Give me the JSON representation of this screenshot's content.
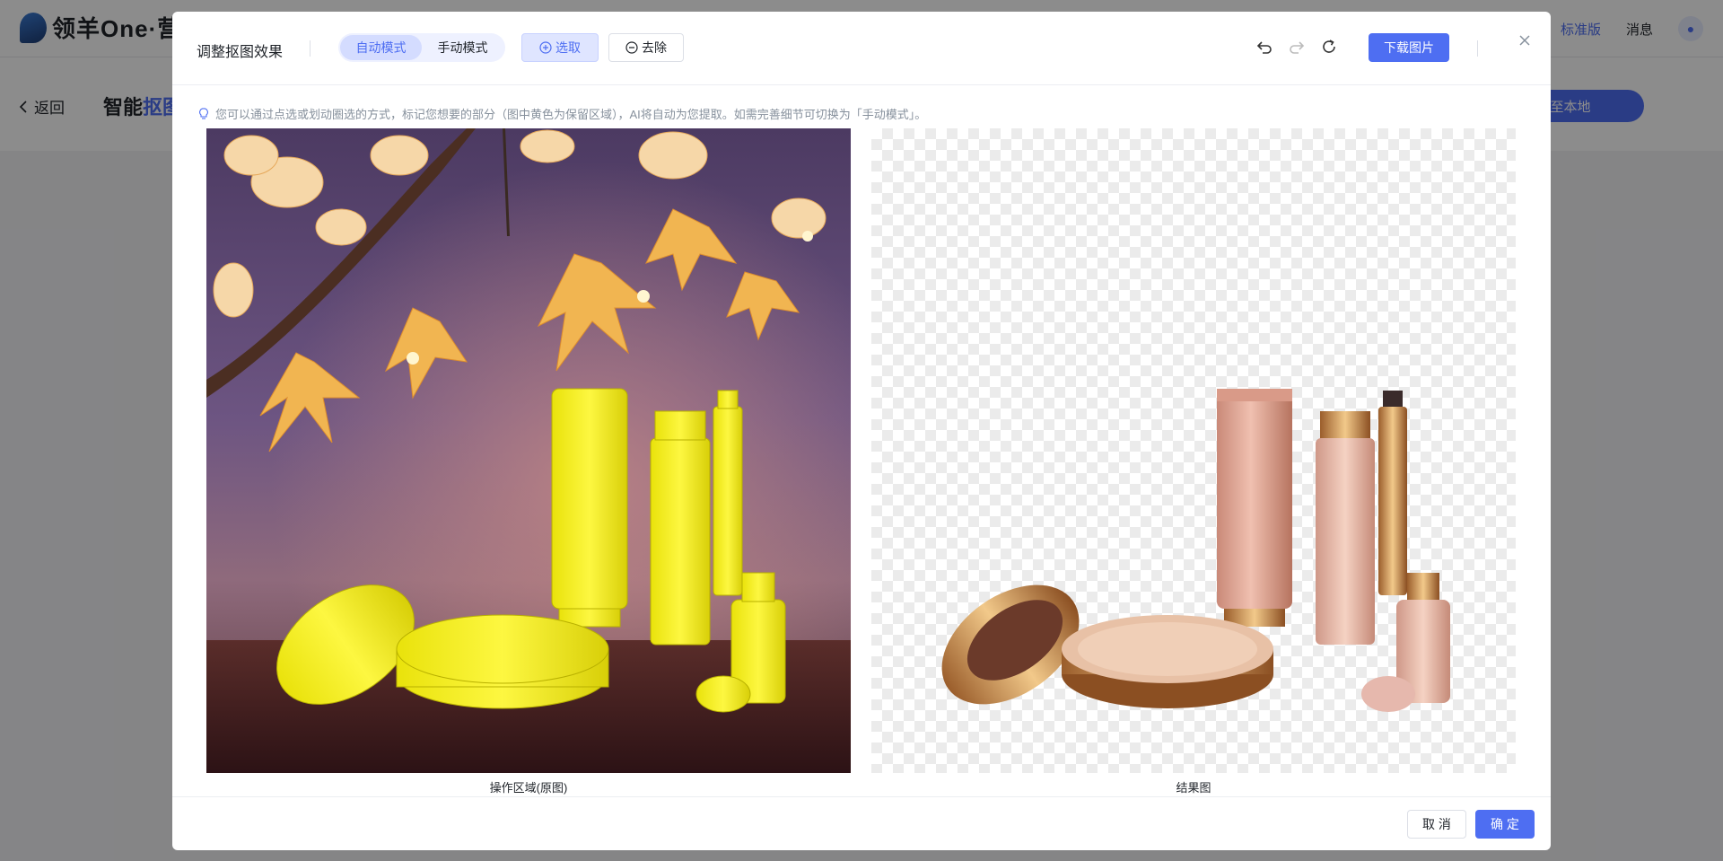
{
  "app": {
    "brand": "领羊One·营销",
    "edition_badge": "标准版",
    "messages_label": "消息"
  },
  "subbar": {
    "back_label": "返回",
    "page_title_prefix": "智能",
    "page_title_accent": "抠图",
    "download_local_label": "下载至本地"
  },
  "modal": {
    "title": "调整抠图效果",
    "modes": [
      {
        "label": "自动模式",
        "active": true
      },
      {
        "label": "手动模式",
        "active": false
      }
    ],
    "select_label": "选取",
    "remove_label": "去除",
    "download_label": "下载图片",
    "hint": "您可以通过点选或划动圈选的方式，标记您想要的部分（图中黄色为保留区域），AI将自动为您提取。如需完善细节可切换为「手动模式」。",
    "left_panel_label": "操作区域(原图)",
    "right_panel_label": "结果图",
    "cancel_label": "取 消",
    "confirm_label": "确 定"
  },
  "colors": {
    "accent": "#4e6ef2",
    "highlight_yellow": "#f3ef1e",
    "product_pink": "#e4ab9a",
    "product_gold": "#c98a4c"
  }
}
